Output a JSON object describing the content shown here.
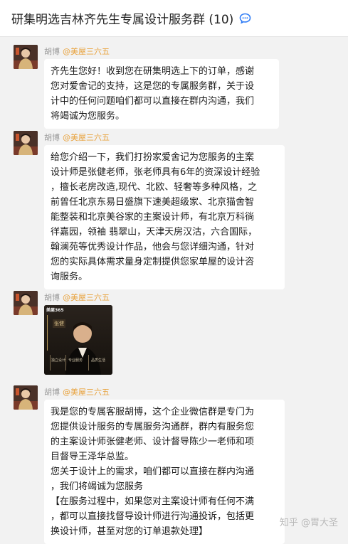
{
  "header": {
    "title": "研集明选吉林齐先生专属设计服务群 (10)",
    "icon": "chat-bubble-icon",
    "accent": "#2f7cf6"
  },
  "messages": [
    {
      "sender": "胡博",
      "org": "@美屋三六五",
      "lines": [
        "齐先生您好！收到您在研集明选上下的订单，感谢",
        "您对爱舍记的支持，这是您的专属服务群，关于设",
        "计中的任何问题咱们都可以直接在群内沟通，我们",
        "将竭诚为您服务。"
      ]
    },
    {
      "sender": "胡博",
      "org": "@美屋三六五",
      "lines": [
        "给您介绍一下，我们打扮家爱舍记为您服务的主案",
        "设计师是张健老师，张老师具有6年的资深设计经验",
        "，擅长老房改造,现代、北欧、轻奢等多种风格，之",
        "前曾任北京东易日盛旗下速美超级家、北京猫舍智",
        "能整装和北京美谷家的主案设计师，有北京万科徜",
        "徉嘉园，领袖  翡翠山，天津天房汉沽，六合国际，",
        "翰澜苑等优秀设计作品，他会与您详细沟通，针对",
        "您的实际具体需求量身定制提供您家单屋的设计咨",
        "询服务。"
      ]
    },
    {
      "sender": "胡博",
      "org": "@美屋三六五",
      "image": {
        "brand": "美屋365",
        "name_tag": "张健",
        "tags": [
          "独立设计",
          "专业服务",
          "品质生活"
        ]
      }
    },
    {
      "sender": "胡博",
      "org": "@美屋三六五",
      "lines": [
        "我是您的专属客服胡博，这个企业微信群是专门为",
        "您提供设计服务的专属服务沟通群，群内有服务您",
        "的主案设计师张健老师、设计督导陈少一老师和项",
        "目督导王泽华总监。",
        "您关于设计上的需求，咱们都可以直接在群内沟通",
        "，我们将竭诚为您服务",
        "【在服务过程中，如果您对主案设计师有任何不满",
        "，都可以直接找督导设计师进行沟通投诉，包括更",
        "换设计师，甚至对您的订单退款处理】"
      ]
    }
  ],
  "watermark": "知乎 @胃大圣"
}
